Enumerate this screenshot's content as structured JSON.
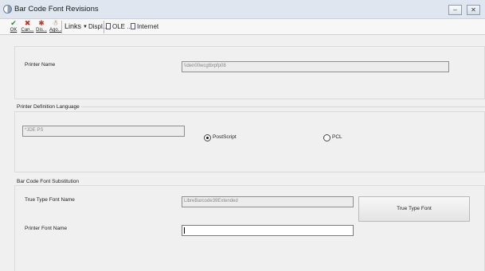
{
  "window": {
    "title": "Bar Code Font Revisions",
    "minimize_glyph": "‒",
    "maximize_glyph": "□",
    "close_glyph": "✕"
  },
  "toolbar": {
    "buttons": [
      {
        "label": "OK",
        "icon": "check-icon",
        "glyph": "✔",
        "color": "#1f8a2a"
      },
      {
        "label": "Can...",
        "icon": "cancel-icon",
        "glyph": "✖",
        "color": "#cc2a1f"
      },
      {
        "label": "Dis...",
        "icon": "display-icon",
        "glyph": "✱",
        "color": "#c03a1a"
      },
      {
        "label": "Ago...",
        "icon": "agent-icon",
        "glyph": "☃",
        "color": "#8a5a2a"
      }
    ],
    "links_label": "Links",
    "display_label": "Displ...",
    "ole_label": "OLE ...",
    "internet_label": "Internet"
  },
  "printer_name": {
    "label": "Printer Name",
    "value": "\\\\den00wcgtbrpfp08"
  },
  "pdl": {
    "section_title": "Printer Definition Language",
    "field_value": "*JDE PS",
    "options": [
      {
        "label": "PostScript",
        "selected": true
      },
      {
        "label": "PCL",
        "selected": false
      }
    ]
  },
  "barcode": {
    "section_title": "Bar Code Font Substitution",
    "ttf_label": "True Type Font Name",
    "ttf_value": "LibreBarcode39Extended",
    "ttf_button": "True Type Font",
    "printer_font_label": "Printer Font Name",
    "printer_font_value": ""
  }
}
